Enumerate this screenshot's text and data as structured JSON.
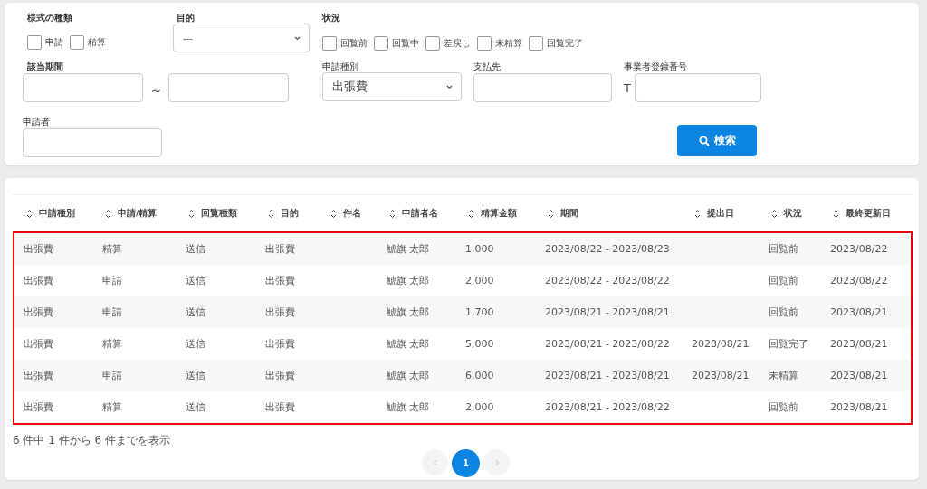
{
  "filters": {
    "form_type": {
      "label": "様式の種類",
      "options": [
        {
          "label": "申請",
          "checked": false
        },
        {
          "label": "精算",
          "checked": false
        }
      ]
    },
    "purpose": {
      "label": "目的",
      "value": "---"
    },
    "status": {
      "label": "状況",
      "options": [
        {
          "label": "回覧前",
          "checked": false
        },
        {
          "label": "回覧中",
          "checked": false
        },
        {
          "label": "差戻し",
          "checked": false
        },
        {
          "label": "未精算",
          "checked": false
        },
        {
          "label": "回覧完了",
          "checked": false
        }
      ]
    },
    "period": {
      "label": "該当期間",
      "separator": "～"
    },
    "application_type": {
      "label": "申請種別",
      "value": "出張費"
    },
    "payee": {
      "label": "支払先"
    },
    "registration_number": {
      "label": "事業者登録番号",
      "prefix": "T"
    },
    "applicant": {
      "label": "申請者"
    },
    "search_button": "検索"
  },
  "table": {
    "highlighted": true,
    "columns": [
      "申請種別",
      "申請/精算",
      "回覧種類",
      "目的",
      "件名",
      "申請者名",
      "精算金額",
      "期間",
      "提出日",
      "状況",
      "最終更新日"
    ],
    "rows": [
      [
        "出張費",
        "精算",
        "送信",
        "出張費",
        "",
        "鯱旗 太郎",
        "1,000",
        "2023/08/22 - 2023/08/23",
        "",
        "回覧前",
        "2023/08/22"
      ],
      [
        "出張費",
        "申請",
        "送信",
        "出張費",
        "",
        "鯱旗 太郎",
        "2,000",
        "2023/08/22 - 2023/08/22",
        "",
        "回覧前",
        "2023/08/22"
      ],
      [
        "出張費",
        "申請",
        "送信",
        "出張費",
        "",
        "鯱旗 太郎",
        "1,700",
        "2023/08/21 - 2023/08/21",
        "",
        "回覧前",
        "2023/08/21"
      ],
      [
        "出張費",
        "精算",
        "送信",
        "出張費",
        "",
        "鯱旗 太郎",
        "5,000",
        "2023/08/21 - 2023/08/22",
        "2023/08/21",
        "回覧完了",
        "2023/08/21"
      ],
      [
        "出張費",
        "申請",
        "送信",
        "出張費",
        "",
        "鯱旗 太郎",
        "6,000",
        "2023/08/21 - 2023/08/21",
        "2023/08/21",
        "未精算",
        "2023/08/21"
      ],
      [
        "出張費",
        "精算",
        "送信",
        "出張費",
        "",
        "鯱旗 太郎",
        "2,000",
        "2023/08/21 - 2023/08/22",
        "",
        "回覧前",
        "2023/08/21"
      ]
    ]
  },
  "footer": {
    "summary": "6 件中 1 件から 6 件までを表示",
    "pages": [
      {
        "label": "1",
        "selected": true
      }
    ]
  }
}
